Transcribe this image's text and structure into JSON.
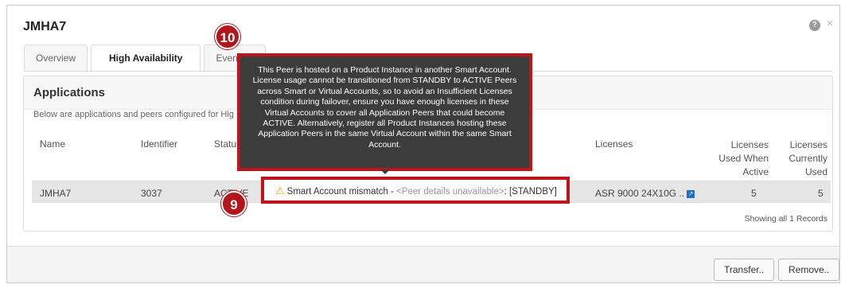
{
  "dialog": {
    "title": "JMHA7",
    "help_icon": "?",
    "close_icon": "×"
  },
  "tabs": [
    {
      "label": "Overview",
      "active": false
    },
    {
      "label": "High Availability",
      "active": true
    },
    {
      "label": "Event Lo",
      "active": false
    }
  ],
  "panel": {
    "title": "Applications",
    "description": "Below are applications and peers configured for Hig"
  },
  "table": {
    "columns": {
      "name": "Name",
      "identifier": "Identifier",
      "status": "Status",
      "licenses": "Licenses",
      "used_when_active_1": "Licenses",
      "used_when_active_2": "Used When",
      "used_when_active_3": "Active",
      "currently_used_1": "Licenses",
      "currently_used_2": "Currently",
      "currently_used_3": "Used"
    },
    "row": {
      "name": "JMHA7",
      "identifier": "3037",
      "status": "ACTIVE",
      "peer_main": "Smart Account mismatch - ",
      "peer_unavail": "<Peer details unavailable>",
      "peer_state": ": [STANDBY]",
      "licenses": "ASR 9000 24X10G ..",
      "used_when_active": "5",
      "currently_used": "5"
    },
    "showing": "Showing all 1 Records"
  },
  "tooltip": {
    "text": "This Peer is hosted on a Product Instance in another Smart Account. License usage cannot be transitioned from STANDBY to ACTIVE Peers across Smart or Virtual Accounts, so to avoid an Insufficient Licenses condition during failover, ensure you have enough licenses in these Virtual Accounts to cover all Application Peers that could become ACTIVE. Alternatively, register all Product Instances hosting these Application Peers in the same Virtual Account within the same Smart Account."
  },
  "callouts": {
    "badge_9": "9",
    "badge_10": "10"
  },
  "buttons": {
    "transfer": "Transfer..",
    "remove": "Remove.."
  },
  "colors": {
    "callout_red": "#c0141b",
    "tooltip_bg": "#3c3c3c",
    "warning": "#f0a500"
  }
}
